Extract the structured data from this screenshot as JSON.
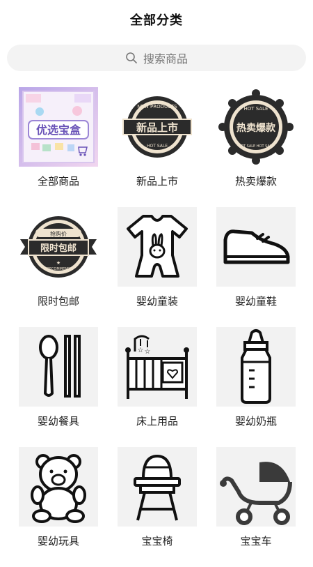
{
  "header": {
    "title": "全部分类"
  },
  "search": {
    "placeholder": "搜索商品",
    "icon": "search-icon"
  },
  "categories": [
    {
      "label": "全部商品",
      "icon": "preferred-treasure-box-image",
      "image_text": "优选宝盒"
    },
    {
      "label": "新品上市",
      "icon": "new-products-badge-icon",
      "image_text": "新品上市",
      "badge_top": "NEW PRODUCTS",
      "badge_bottom": "HOT SALE"
    },
    {
      "label": "热卖爆款",
      "icon": "hot-sale-badge-icon",
      "image_text": "热卖爆款",
      "badge_top": "HOT SALE",
      "badge_bottom": "HOT SALE HOT SALE"
    },
    {
      "label": "限时包邮",
      "icon": "free-shipping-badge-icon",
      "image_text": "限时包邮",
      "badge_top": "抢购价",
      "badge_bottom": "RECOMMEND"
    },
    {
      "label": "婴幼童装",
      "icon": "baby-romper-icon"
    },
    {
      "label": "婴幼童鞋",
      "icon": "baby-shoe-icon"
    },
    {
      "label": "婴幼餐具",
      "icon": "spoon-chopsticks-icon"
    },
    {
      "label": "床上用品",
      "icon": "crib-icon"
    },
    {
      "label": "婴幼奶瓶",
      "icon": "baby-bottle-icon"
    },
    {
      "label": "婴幼玩具",
      "icon": "teddy-bear-icon"
    },
    {
      "label": "宝宝椅",
      "icon": "high-chair-icon"
    },
    {
      "label": "宝宝车",
      "icon": "stroller-icon"
    }
  ]
}
